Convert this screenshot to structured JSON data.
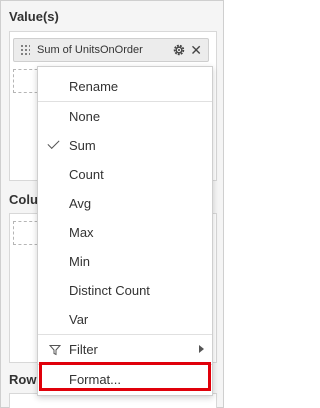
{
  "sections": {
    "values_title": "Value(s)",
    "columns_title": "Colu",
    "rows_title": "Row"
  },
  "field_pill": {
    "label": "Sum of UnitsOnOrder",
    "icons": [
      "drag-handle-icon",
      "gear-icon",
      "close-icon"
    ],
    "close_glyph": "✕"
  },
  "context_menu": {
    "rename": "Rename",
    "aggregations": [
      "None",
      "Sum",
      "Count",
      "Avg",
      "Max",
      "Min",
      "Distinct Count",
      "Var"
    ],
    "selected": "Sum",
    "filter": "Filter",
    "format": "Format..."
  },
  "colors": {
    "highlight": "#e0000a",
    "panel_bg": "#f5f5f5"
  }
}
